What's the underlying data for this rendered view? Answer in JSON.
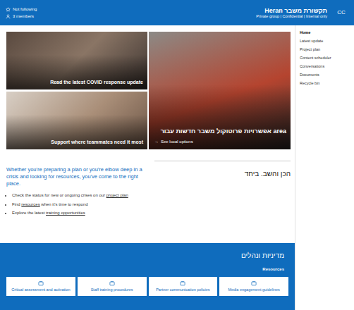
{
  "header": {
    "title": "Heran תקשורת משבר",
    "subtitle": "Private group | Confidential | Internal only",
    "logo": "CC",
    "follow": "Not following",
    "members": "3 members"
  },
  "nav": [
    {
      "label": "Home",
      "selected": true
    },
    {
      "label": "Latest update",
      "selected": false
    },
    {
      "label": "Project plan",
      "selected": false
    },
    {
      "label": "Content scheduler",
      "selected": false
    },
    {
      "label": "Conversations",
      "selected": false
    },
    {
      "label": "Documents",
      "selected": false
    },
    {
      "label": "Recycle bin",
      "selected": false
    }
  ],
  "hero": {
    "main": {
      "title": "אפשרויות פרוטוקול משבר חדשות עבור area",
      "link": "See local options",
      "arrow": "→"
    },
    "tiles": [
      {
        "title": "Read the latest COVID response update"
      },
      {
        "title": "Support where teammates need it most"
      }
    ]
  },
  "intro": {
    "heading": "הכן והשב. ביחד",
    "text": "Whether you're preparing a plan or you're elbow deep in a crisis and looking for resources, you've come to the right place.",
    "bullets": [
      {
        "before": "Check the status for new or ongoing crises on our ",
        "link": "project plan",
        "after": ""
      },
      {
        "before": "Find ",
        "link": "resources",
        "after": " when it's time to respond"
      },
      {
        "before": "Explore the latest ",
        "link": "training opportunities",
        "after": ""
      }
    ]
  },
  "policies": {
    "heading": "מדיניות ונהלים",
    "subheading": "Resources",
    "cards": [
      {
        "label": "Media engagement guidelines"
      },
      {
        "label": "Partner communication policies"
      },
      {
        "label": "Staff training procedures"
      },
      {
        "label": "Critical assessment and activation"
      }
    ]
  }
}
